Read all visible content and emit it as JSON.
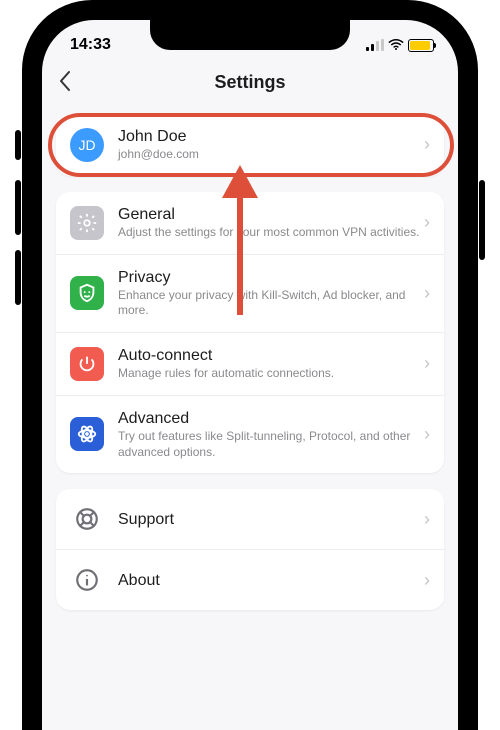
{
  "statusBar": {
    "time": "14:33"
  },
  "header": {
    "title": "Settings"
  },
  "account": {
    "initials": "JD",
    "name": "John Doe",
    "email": "john@doe.com"
  },
  "groups": [
    {
      "icon": "gear",
      "title": "General",
      "sub": "Adjust the settings for your most common VPN activities."
    },
    {
      "icon": "shield",
      "title": "Privacy",
      "sub": "Enhance your privacy with Kill-Switch, Ad blocker, and more."
    },
    {
      "icon": "power",
      "title": "Auto-connect",
      "sub": "Manage rules for automatic connections."
    },
    {
      "icon": "atom",
      "title": "Advanced",
      "sub": "Try out features like Split-tunneling, Protocol, and other advanced options."
    }
  ],
  "extra": [
    {
      "icon": "support",
      "title": "Support"
    },
    {
      "icon": "info",
      "title": "About"
    }
  ],
  "colors": {
    "accent": "#3b9bff",
    "green": "#30b14a",
    "red": "#f15b50",
    "blue": "#2a5fd8",
    "highlight": "#de4f3a",
    "battery": "#ffcc00"
  }
}
